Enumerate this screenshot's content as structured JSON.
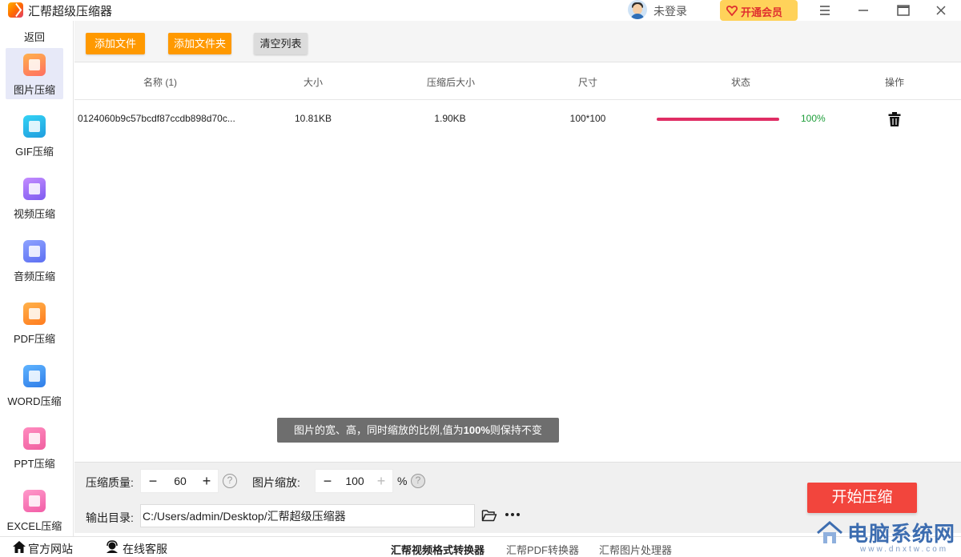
{
  "app": {
    "title": "汇帮超级压缩器"
  },
  "titlebar": {
    "login_text": "未登录",
    "vip_label": "开通会员"
  },
  "sidebar": {
    "back_label": "返回",
    "items": [
      {
        "label": "图片压缩",
        "icon": "image-icon"
      },
      {
        "label": "GIF压缩",
        "icon": "gif-icon"
      },
      {
        "label": "视频压缩",
        "icon": "video-icon"
      },
      {
        "label": "音频压缩",
        "icon": "audio-icon"
      },
      {
        "label": "PDF压缩",
        "icon": "pdf-icon"
      },
      {
        "label": "WORD压缩",
        "icon": "word-icon"
      },
      {
        "label": "PPT压缩",
        "icon": "ppt-icon"
      },
      {
        "label": "EXCEL压缩",
        "icon": "excel-icon"
      }
    ]
  },
  "toolbar": {
    "add_file": "添加文件",
    "add_folder": "添加文件夹",
    "clear_list": "清空列表"
  },
  "table": {
    "headers": [
      "名称 (1)",
      "大小",
      "压缩后大小",
      "尺寸",
      "状态",
      "操作"
    ],
    "rows": [
      {
        "name": "0124060b9c57bcdf87ccdb898d70c...",
        "size": "10.81KB",
        "compressed": "1.90KB",
        "dimensions": "100*100",
        "progress_pct": 100,
        "status_text": "100%"
      }
    ]
  },
  "tooltip": {
    "text_prefix": "图片的宽、高，同时缩放的比例,值为",
    "text_bold": "100%",
    "text_suffix": "则保持不变"
  },
  "settings": {
    "quality_label": "压缩质量:",
    "quality_value": "60",
    "scale_label": "图片缩放:",
    "scale_value": "100",
    "scale_unit": "%",
    "output_label": "输出目录:",
    "output_path": "C:/Users/admin/Desktop/汇帮超级压缩器",
    "start_label": "开始压缩",
    "minus": "−",
    "plus": "+",
    "help": "?"
  },
  "footer": {
    "website": "官方网站",
    "support": "在线客服",
    "links": [
      "汇帮视频格式转换器",
      "汇帮PDF转换器",
      "汇帮图片处理器"
    ]
  },
  "watermark": {
    "text": "电脑系统网",
    "sub": "www.dnxtw.com"
  },
  "colors": {
    "accent_orange": "#ff9900",
    "start_red": "#f2453d",
    "progress": "#e02d64",
    "success_green": "#1e9e3a",
    "vip_gold": "#ffd25a"
  }
}
